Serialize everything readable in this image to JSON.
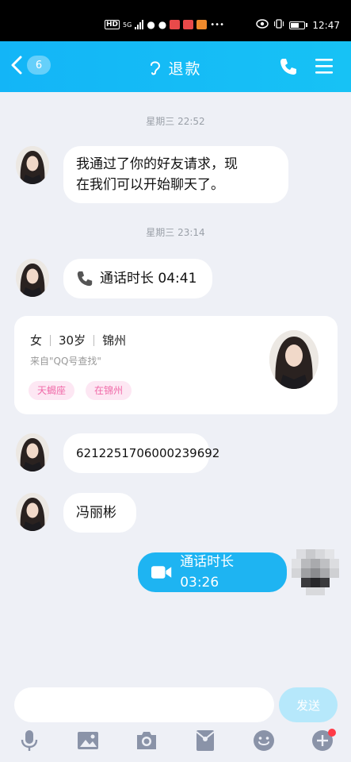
{
  "status_bar": {
    "hd_label": "HD",
    "signal_label": "5G",
    "time": "12:47"
  },
  "header": {
    "back_count": "6",
    "title": "退款",
    "accent": "#16b9f6"
  },
  "messages": [
    {
      "type": "time",
      "text": "星期三 22:52"
    },
    {
      "type": "bubble",
      "side": "left",
      "text_line1": "我通过了你的好友请求，现",
      "text_line2": "在我们可以开始聊天了。"
    },
    {
      "type": "time",
      "text": "星期三 23:14"
    },
    {
      "type": "call",
      "side": "left",
      "text": "通话时长 04:41"
    },
    {
      "type": "bubble",
      "side": "left",
      "text": "6212251706000239692"
    },
    {
      "type": "bubble",
      "side": "left",
      "text": "冯丽彬"
    },
    {
      "type": "call",
      "side": "right",
      "text": "通话时长 03:26"
    }
  ],
  "profile_card": {
    "gender": "女",
    "age": "30岁",
    "city": "锦州",
    "source": "来自\"QQ号查找\"",
    "tags": [
      "天蝎座",
      "在锦州"
    ]
  },
  "input": {
    "placeholder": "",
    "send_label": "发送"
  },
  "toolbar": [
    "mic-icon",
    "image-icon",
    "camera-icon",
    "red-packet-icon",
    "emoji-icon",
    "plus-icon"
  ]
}
